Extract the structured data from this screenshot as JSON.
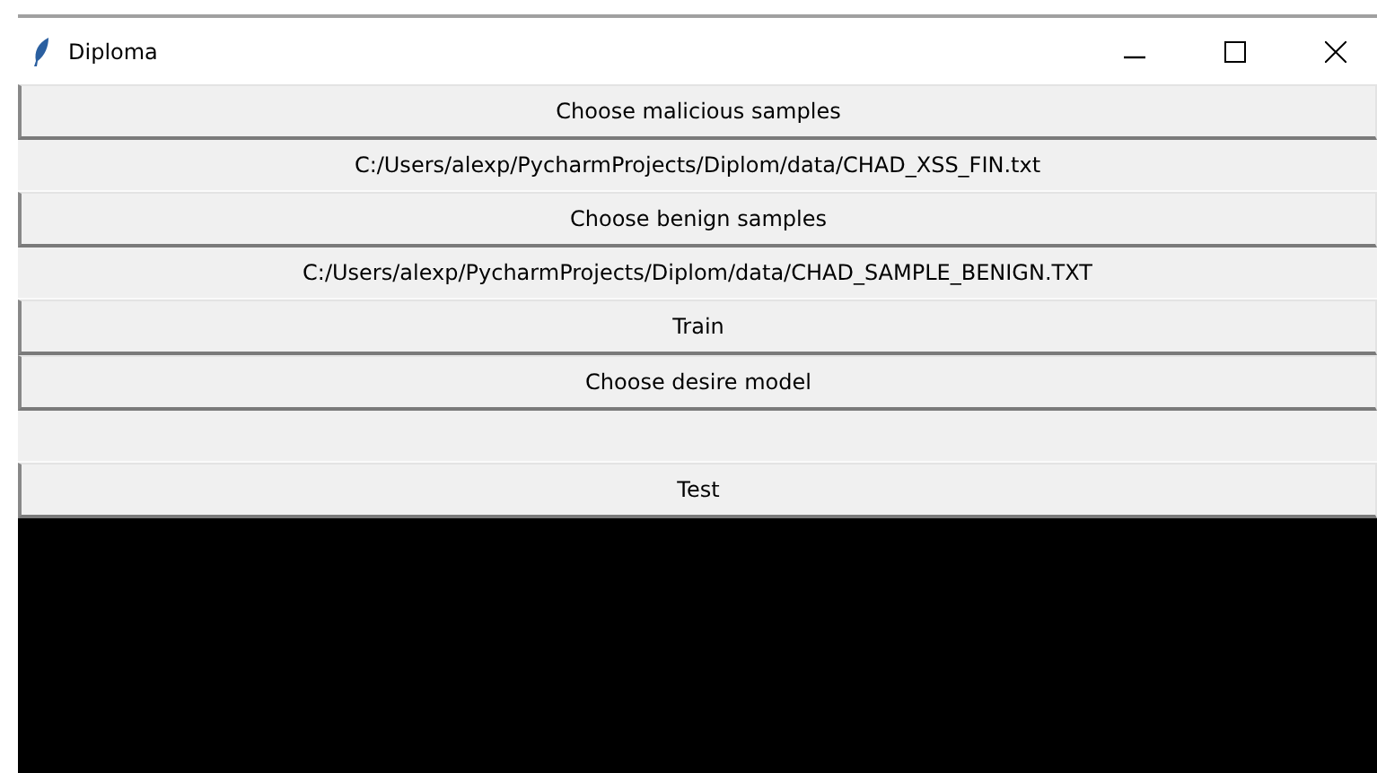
{
  "window": {
    "title": "Diploma"
  },
  "rows": [
    {
      "kind": "button",
      "text": "Choose malicious samples"
    },
    {
      "kind": "label",
      "text": "C:/Users/alexp/PycharmProjects/Diplom/data/CHAD_XSS_FIN.txt"
    },
    {
      "kind": "button",
      "text": "Choose benign samples"
    },
    {
      "kind": "label",
      "text": "C:/Users/alexp/PycharmProjects/Diplom/data/CHAD_SAMPLE_BENIGN.TXT"
    },
    {
      "kind": "button",
      "text": "Train"
    },
    {
      "kind": "button",
      "text": "Choose desire model"
    },
    {
      "kind": "label"
    },
    {
      "kind": "button",
      "text": "Test"
    }
  ],
  "output": {
    "kind": "console"
  }
}
